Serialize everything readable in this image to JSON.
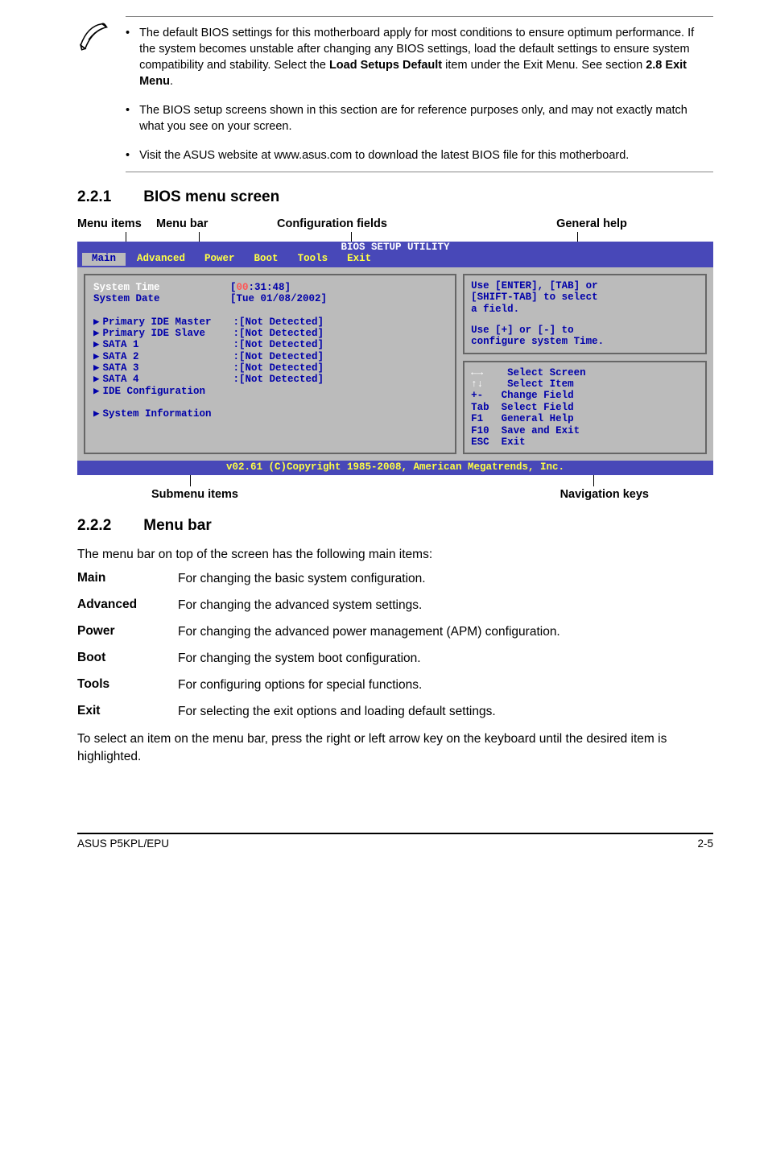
{
  "notes": {
    "item1_pre": "The default BIOS settings for this motherboard apply for most conditions to ensure optimum performance. If the system becomes unstable after changing any BIOS settings, load the default settings to ensure system compatibility and stability. Select the ",
    "item1_bold1": "Load Setups Default",
    "item1_mid": " item under the Exit Menu. See section ",
    "item1_bold2": "2.8 Exit Menu",
    "item1_post": ".",
    "item2": "The BIOS setup screens shown in this section are for reference purposes only, and may not exactly match what you see on your screen.",
    "item3": "Visit the ASUS website at www.asus.com to download the latest BIOS file for this motherboard."
  },
  "sec221": {
    "num": "2.2.1",
    "title": "BIOS menu screen"
  },
  "labels": {
    "menu_items": "Menu items",
    "menu_bar": "Menu bar",
    "config_fields": "Configuration fields",
    "general_help": "General help",
    "submenu_items": "Submenu items",
    "nav_keys": "Navigation keys"
  },
  "bios": {
    "header": "BIOS SETUP UTILITY",
    "tabs": {
      "main": "Main",
      "advanced": "Advanced",
      "power": "Power",
      "boot": "Boot",
      "tools": "Tools",
      "exit": "Exit"
    },
    "rows": {
      "system_time": "System Time",
      "system_date": "System Date",
      "time_pre": "[",
      "time_hh": "00",
      "time_rest": ":31:48]",
      "date_val": "[Tue 01/08/2002]",
      "pim": "Primary IDE Master",
      "pis": "Primary IDE Slave",
      "sata1": "SATA 1",
      "sata2": "SATA 2",
      "sata3": "SATA 3",
      "sata4": "SATA 4",
      "nd": ":[Not Detected]",
      "ide_conf": "IDE Configuration",
      "sys_info": "System Information"
    },
    "help": {
      "l1": "Use [ENTER], [TAB] or",
      "l2": "[SHIFT-TAB] to select",
      "l3": "a field.",
      "l4": "Use [+] or [-] to",
      "l5": "configure system Time."
    },
    "nav": {
      "r1": "    Select Screen",
      "r2": "    Select Item",
      "r3": "+-   Change Field",
      "r4": "Tab  Select Field",
      "r5": "F1   General Help",
      "r6": "F10  Save and Exit",
      "r7": "ESC  Exit"
    },
    "footer": "v02.61 (C)Copyright 1985-2008, American Megatrends, Inc."
  },
  "sec222": {
    "num": "2.2.2",
    "title": "Menu bar"
  },
  "menubar_intro": "The menu bar on top of the screen has the following main items:",
  "defs": {
    "main": {
      "t": "Main",
      "d": "For changing the basic system configuration."
    },
    "advanced": {
      "t": "Advanced",
      "d": "For changing the advanced system settings."
    },
    "power": {
      "t": "Power",
      "d": "For changing the advanced power management (APM) configuration."
    },
    "boot": {
      "t": "Boot",
      "d": "For changing the system boot configuration."
    },
    "tools": {
      "t": "Tools",
      "d": "For configuring options for special functions."
    },
    "exit": {
      "t": "Exit",
      "d": "For selecting the exit options and loading default settings."
    }
  },
  "select_text": "To select an item on the menu bar, press the right or left arrow key on the keyboard until the desired item is highlighted.",
  "footer": {
    "left": "ASUS P5KPL/EPU",
    "right": "2-5"
  }
}
